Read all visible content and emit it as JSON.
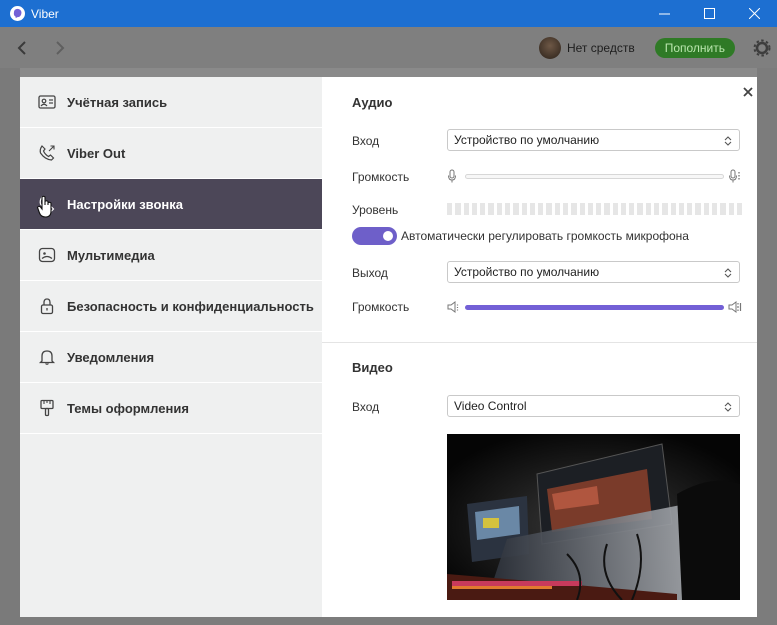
{
  "window": {
    "title": "Viber",
    "controls": [
      "minimize-icon",
      "maximize-icon",
      "close-icon"
    ]
  },
  "toolbar": {
    "balance_text": "Нет средств",
    "topup_label": "Пополнить"
  },
  "sidebar": {
    "items": [
      {
        "label": "Учётная запись",
        "icon": "account-card-icon"
      },
      {
        "label": "Viber Out",
        "icon": "phone-out-icon"
      },
      {
        "label": "Настройки звонка",
        "icon": "call-settings-icon",
        "active": true
      },
      {
        "label": "Мультимедиа",
        "icon": "media-icon"
      },
      {
        "label": "Безопасность и конфиденциальность",
        "icon": "lock-icon"
      },
      {
        "label": "Уведомления",
        "icon": "bell-icon"
      },
      {
        "label": "Темы оформления",
        "icon": "brush-icon"
      }
    ]
  },
  "audio": {
    "title": "Аудио",
    "input_label": "Вход",
    "input_value": "Устройство по умолчанию",
    "input_volume_label": "Громкость",
    "input_volume": 0,
    "level_label": "Уровень",
    "auto_gain_label": "Автоматически регулировать громкость микрофона",
    "auto_gain_on": true,
    "output_label": "Выход",
    "output_value": "Устройство по умолчанию",
    "output_volume_label": "Громкость",
    "output_volume": 1.0
  },
  "video": {
    "title": "Видео",
    "input_label": "Вход",
    "input_value": "Video Control"
  },
  "colors": {
    "titlebar": "#1d6fd1",
    "active_item": "#4c4758",
    "accent": "#7360d6",
    "topup_bg": "#2f7a26"
  }
}
